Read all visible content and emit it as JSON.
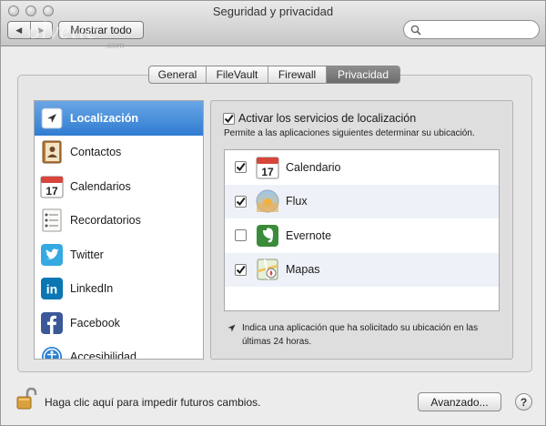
{
  "window": {
    "title": "Seguridad y privacidad"
  },
  "toolbar": {
    "back_label": "◀",
    "forward_label": "▶",
    "show_all_label": "Mostrar todo",
    "watermark": "olvetic",
    "watermark_sub": ".com",
    "search": {
      "value": "",
      "placeholder": ""
    }
  },
  "tabs": [
    {
      "label": "General",
      "active": false
    },
    {
      "label": "FileVault",
      "active": false
    },
    {
      "label": "Firewall",
      "active": false
    },
    {
      "label": "Privacidad",
      "active": true
    }
  ],
  "sidebar": {
    "items": [
      {
        "label": "Localización",
        "icon": "location-arrow-icon",
        "selected": true
      },
      {
        "label": "Contactos",
        "icon": "contacts-icon",
        "selected": false
      },
      {
        "label": "Calendarios",
        "icon": "calendar-icon",
        "selected": false
      },
      {
        "label": "Recordatorios",
        "icon": "reminders-icon",
        "selected": false
      },
      {
        "label": "Twitter",
        "icon": "twitter-icon",
        "selected": false
      },
      {
        "label": "LinkedIn",
        "icon": "linkedin-icon",
        "selected": false
      },
      {
        "label": "Facebook",
        "icon": "facebook-icon",
        "selected": false
      },
      {
        "label": "Accesibilidad",
        "icon": "accessibility-icon",
        "selected": false
      }
    ]
  },
  "location": {
    "enable_label": "Activar los servicios de localización",
    "enabled": true,
    "description": "Permite a las aplicaciones siguientes determinar su ubicación.",
    "apps": [
      {
        "label": "Calendario",
        "icon": "calendar-icon",
        "checked": true
      },
      {
        "label": "Flux",
        "icon": "flux-icon",
        "checked": true
      },
      {
        "label": "Evernote",
        "icon": "evernote-icon",
        "checked": false
      },
      {
        "label": "Mapas",
        "icon": "maps-icon",
        "checked": true
      }
    ],
    "footnote": "Indica una aplicación que ha solicitado su ubicación en las últimas 24 horas."
  },
  "calendar_icon_day": "17",
  "footer": {
    "lock_text": "Haga clic aquí para impedir futuros cambios.",
    "advanced_label": "Avanzado...",
    "help_label": "?"
  },
  "colors": {
    "selection": "#2f7cd1",
    "twitter": "#35a9e1",
    "linkedin": "#0a76b3",
    "facebook": "#3b5998",
    "evernote": "#3b8c3a"
  }
}
